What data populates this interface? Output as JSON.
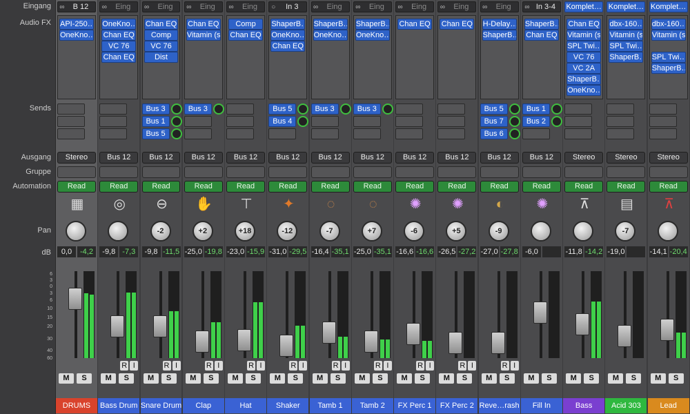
{
  "row_labels": {
    "input": "Eingang",
    "audio_fx": "Audio FX",
    "sends": "Sends",
    "output": "Ausgang",
    "group": "Gruppe",
    "automation": "Automation",
    "pan": "Pan",
    "db": "dB"
  },
  "db_scale": [
    "6",
    "3",
    "0",
    "3",
    "6",
    "10",
    "15",
    "20",
    "30",
    "40",
    "60"
  ],
  "buttons": {
    "mute": "M",
    "solo": "S",
    "record": "R",
    "input_monitor": "I"
  },
  "icons": {
    "link": "link-icon",
    "input_monitor": "circle-icon",
    "play": "triangle-icon"
  },
  "strips": [
    {
      "name": "DRUMS",
      "color": "#d9432c",
      "input": "B 12",
      "input_icon": "link",
      "input_dim": false,
      "fx": [
        "API-250…",
        "OneKno…"
      ],
      "fx_gray": true,
      "sends": [],
      "output": "Stereo",
      "automation": "Read",
      "pan": "",
      "db_level": "0,0",
      "db_peak": "-4,2",
      "fader": 0.78,
      "meters": [
        0.76,
        0.74
      ],
      "ri": false,
      "icon": "drum-machine",
      "selected": true
    },
    {
      "name": "Bass Drum",
      "color": "#3a62d4",
      "input": "Eing",
      "input_icon": "link",
      "input_dim": true,
      "fx": [
        "OneKno…",
        "Chan EQ",
        "VC 76",
        "Chan EQ"
      ],
      "sends": [],
      "output": "Bus 12",
      "automation": "Read",
      "pan": "",
      "db_level": "-9,8",
      "db_peak": "-7,3",
      "fader": 0.42,
      "meters": [
        0.77,
        0.77
      ],
      "ri": true,
      "icon": "bass-drum"
    },
    {
      "name": "Snare Drum",
      "color": "#3a62d4",
      "input": "Eing",
      "input_icon": "link",
      "input_dim": true,
      "fx": [
        "Chan EQ",
        "Comp",
        "VC 76",
        "Dist"
      ],
      "sends": [
        {
          "label": "Bus 3",
          "on": true
        },
        {
          "label": "Bus 1",
          "on": true
        },
        {
          "label": "Bus 5",
          "on": true
        }
      ],
      "output": "Bus 12",
      "automation": "Read",
      "pan": "-2",
      "db_level": "-9,8",
      "db_peak": "-11,5",
      "fader": 0.42,
      "meters": [
        0.55,
        0.55
      ],
      "ri": true,
      "icon": "snare"
    },
    {
      "name": "Clap",
      "color": "#3a62d4",
      "input": "Eing",
      "input_icon": "link",
      "input_dim": true,
      "fx": [
        "Chan EQ",
        "Vitamin (s"
      ],
      "sends": [
        {
          "label": "Bus 3",
          "on": true
        }
      ],
      "output": "Bus 12",
      "automation": "Read",
      "pan": "+2",
      "db_level": "-25,0",
      "db_peak": "-19,8",
      "fader": 0.22,
      "meters": [
        0.42,
        0.42
      ],
      "ri": true,
      "icon": "hand"
    },
    {
      "name": "Hat",
      "color": "#3a62d4",
      "input": "Eing",
      "input_icon": "link",
      "input_dim": true,
      "fx": [
        "Comp",
        "Chan EQ"
      ],
      "sends": [],
      "output": "Bus 12",
      "automation": "Read",
      "pan": "+18",
      "db_level": "-23,0",
      "db_peak": "-15,9",
      "fader": 0.24,
      "meters": [
        0.65,
        0.65
      ],
      "ri": true,
      "icon": "hihat"
    },
    {
      "name": "Shaker",
      "color": "#3a62d4",
      "input": "In 3",
      "input_icon": "circle",
      "input_dim": false,
      "fx": [
        "ShaperB…",
        "OneKno…",
        "Chan EQ"
      ],
      "sends": [
        {
          "label": "Bus 5",
          "on": true
        },
        {
          "label": "Bus 4",
          "on": true
        }
      ],
      "output": "Bus 12",
      "automation": "Read",
      "pan": "-12",
      "db_level": "-31,0",
      "db_peak": "-29,5",
      "fader": 0.16,
      "meters": [
        0.38,
        0.38
      ],
      "ri": true,
      "icon": "maracas"
    },
    {
      "name": "Tamb 1",
      "color": "#3a62d4",
      "input": "Eing",
      "input_icon": "link",
      "input_dim": true,
      "fx": [
        "ShaperB…",
        "OneKno…"
      ],
      "sends": [
        {
          "label": "Bus 3",
          "on": true
        }
      ],
      "output": "Bus 12",
      "automation": "Read",
      "pan": "-7",
      "db_level": "-16,4",
      "db_peak": "-35,1",
      "fader": 0.34,
      "meters": [
        0.25,
        0.25
      ],
      "ri": true,
      "icon": "tambourine"
    },
    {
      "name": "Tamb 2",
      "color": "#3a62d4",
      "input": "Eing",
      "input_icon": "link",
      "input_dim": true,
      "fx": [
        "ShaperB…",
        "OneKno…"
      ],
      "sends": [
        {
          "label": "Bus 3",
          "on": true
        }
      ],
      "output": "Bus 12",
      "automation": "Read",
      "pan": "+7",
      "db_level": "-25,0",
      "db_peak": "-35,1",
      "fader": 0.22,
      "meters": [
        0.22,
        0.22
      ],
      "ri": true,
      "icon": "tambourine"
    },
    {
      "name": "FX Perc 1",
      "color": "#3a62d4",
      "input": "Eing",
      "input_icon": "link",
      "input_dim": true,
      "fx": [
        "Chan EQ"
      ],
      "sends": [],
      "output": "Bus 12",
      "automation": "Read",
      "pan": "-6",
      "db_level": "-16,6",
      "db_peak": "-16,6",
      "fader": 0.32,
      "meters": [
        0.2,
        0.2
      ],
      "ri": true,
      "icon": "sparkle"
    },
    {
      "name": "FX Perc 2",
      "color": "#3a62d4",
      "input": "Eing",
      "input_icon": "link",
      "input_dim": true,
      "fx": [
        "Chan EQ"
      ],
      "sends": [],
      "output": "Bus 12",
      "automation": "Read",
      "pan": "+5",
      "db_level": "-26,5",
      "db_peak": "-27,2",
      "fader": 0.2,
      "meters": [
        0.0,
        0.0
      ],
      "ri": true,
      "icon": "sparkle"
    },
    {
      "name": "Reve…rash",
      "color": "#3a62d4",
      "input": "Eing",
      "input_icon": "link",
      "input_dim": true,
      "fx": [
        "H-Delay…",
        "ShaperB…"
      ],
      "sends": [
        {
          "label": "Bus 5",
          "on": true
        },
        {
          "label": "Bus 7",
          "on": true
        },
        {
          "label": "Bus 6",
          "on": true
        }
      ],
      "output": "Bus 12",
      "automation": "Read",
      "pan": "-9",
      "db_level": "-27,0",
      "db_peak": "-27,8",
      "fader": 0.2,
      "meters": [
        0.0,
        0.0
      ],
      "ri": true,
      "icon": "cymbal"
    },
    {
      "name": "Fill In",
      "color": "#3a62d4",
      "input": "In 3-4",
      "input_icon": "link",
      "input_dim": false,
      "fx": [
        "ShaperB…",
        "Chan EQ"
      ],
      "sends": [
        {
          "label": "Bus 1",
          "on": true
        },
        {
          "label": "Bus 2",
          "on": true
        }
      ],
      "output": "Bus 12",
      "automation": "Read",
      "pan": "",
      "db_level": "-6,0",
      "db_peak": "",
      "fader": 0.6,
      "meters": [
        0.0,
        0.0
      ],
      "ri": false,
      "icon": "sparkle"
    },
    {
      "name": "Bass",
      "color": "#7a3fd0",
      "input": "Komplet…",
      "input_icon": "",
      "input_dim": false,
      "input_blue": true,
      "fx": [
        "Chan EQ",
        "Vitamin (s",
        "SPL Twi…",
        "VC 76",
        "VC 2A",
        "ShaperB…",
        "OneKno…"
      ],
      "sends": [],
      "output": "Stereo",
      "automation": "Read",
      "pan": "",
      "db_level": "-11,8",
      "db_peak": "-14,2",
      "fader": 0.45,
      "meters": [
        0.66,
        0.66
      ],
      "ri": false,
      "icon": "keyboard-stand"
    },
    {
      "name": "Acid 303",
      "color": "#2fb83f",
      "input": "Komplet…",
      "input_icon": "",
      "input_dim": false,
      "input_blue": true,
      "fx": [
        "dbx-160…",
        "Vitamin (s",
        "SPL Twi…",
        "ShaperB…"
      ],
      "sends": [],
      "output": "Stereo",
      "automation": "Read",
      "pan": "-7",
      "db_level": "-19,0",
      "db_peak": "",
      "fader": 0.29,
      "meters": [
        0.0,
        0.0
      ],
      "ri": false,
      "icon": "synth"
    },
    {
      "name": "Lead",
      "color": "#d98a1e",
      "input": "Komplet…",
      "input_icon": "",
      "input_dim": false,
      "input_blue": true,
      "fx": [
        "dbx-160…",
        "Vitamin (s",
        "",
        "SPL Twi…",
        "ShaperB…"
      ],
      "fx_gray": true,
      "sends": [],
      "output": "Stereo",
      "automation": "Read",
      "pan": "",
      "db_level": "-14,1",
      "db_peak": "-20,4",
      "fader": 0.37,
      "meters": [
        0.3,
        0.3
      ],
      "ri": false,
      "icon": "keyboard-stand-red"
    }
  ]
}
